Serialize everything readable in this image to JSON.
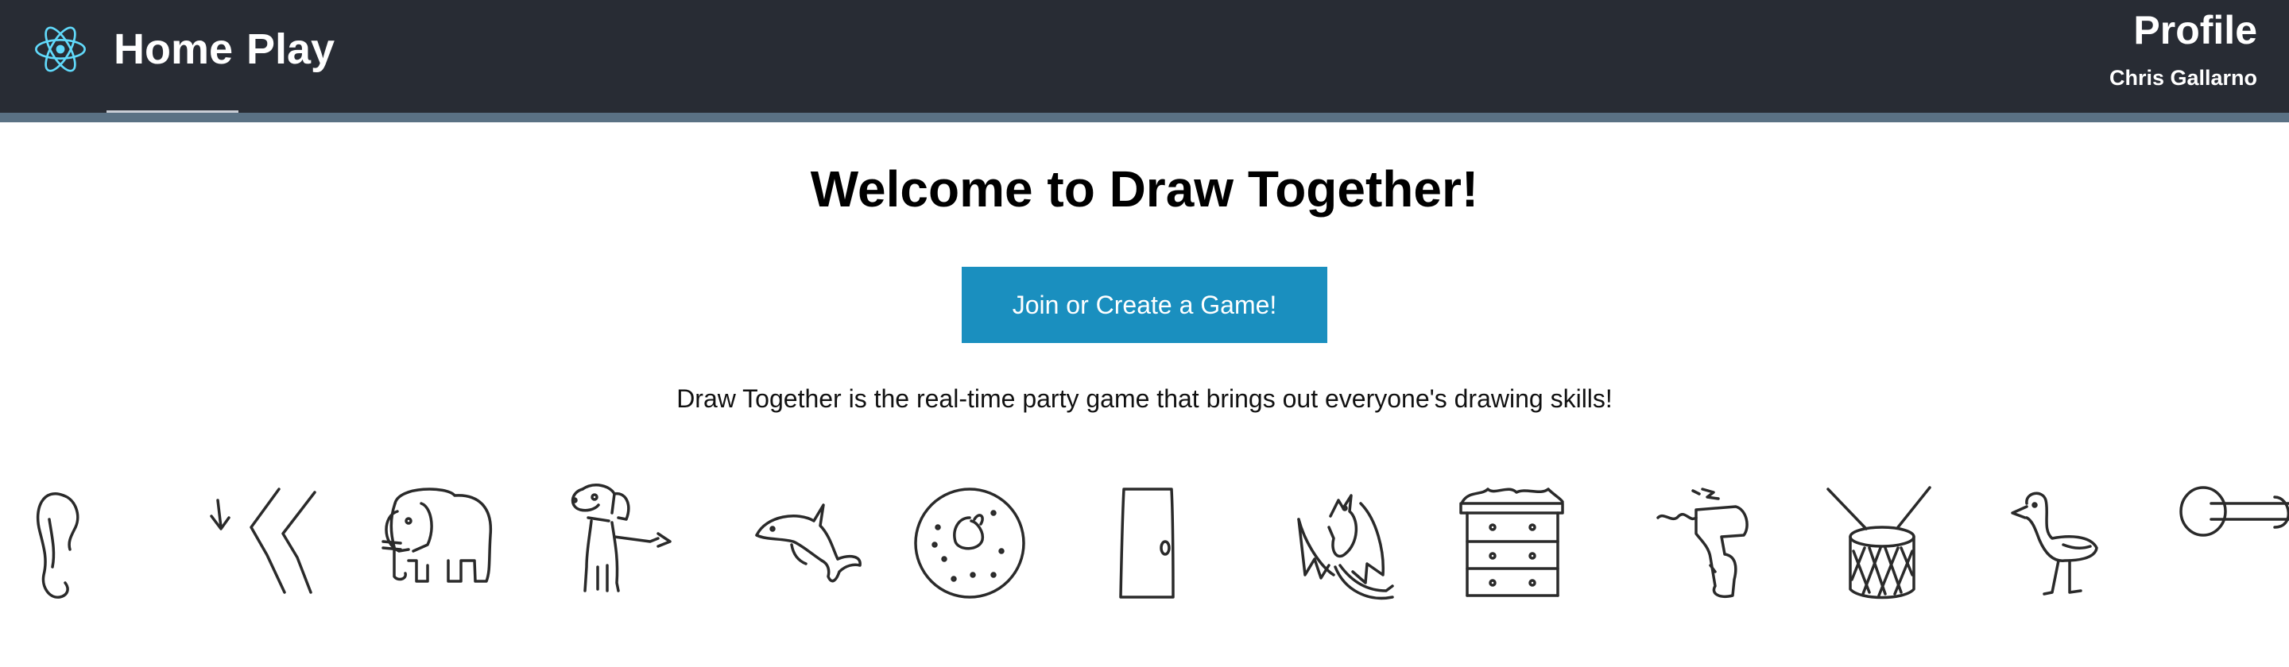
{
  "nav": {
    "logo_icon": "atom-logo-icon",
    "home_label": "Home",
    "play_label": "Play",
    "active_tab": "Home"
  },
  "profile": {
    "title": "Profile",
    "user_name": "Chris Gallarno"
  },
  "main": {
    "heading": "Welcome to Draw Together!",
    "cta_label": "Join or Create a Game!",
    "tagline": "Draw Together is the real-time party game that brings out everyone's drawing skills!"
  },
  "doodles": [
    "ear",
    "knee",
    "elephant",
    "dog",
    "dolphin",
    "donut",
    "door",
    "dragon",
    "dresser",
    "drill",
    "drum",
    "duck",
    "dumbbell"
  ],
  "colors": {
    "navbar_bg": "#282c34",
    "navbar_border": "#5a7184",
    "logo_cyan": "#61dafb",
    "button_bg": "#1a8fbf",
    "button_text": "#ffffff"
  }
}
